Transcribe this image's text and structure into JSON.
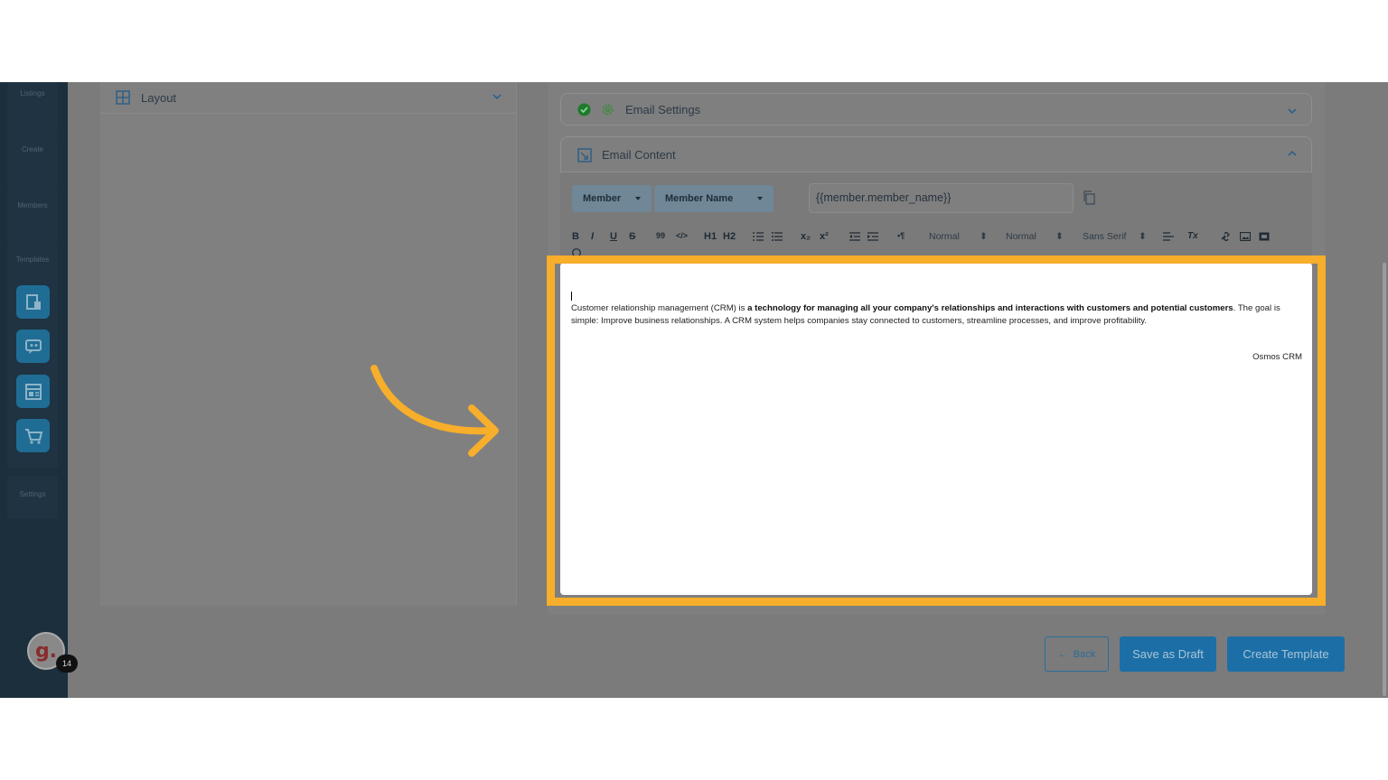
{
  "sidebar": {
    "labels": [
      "Listings",
      "Create",
      "Members",
      "Templates",
      "Settings"
    ],
    "template_buttons": [
      "document-icon",
      "chat-icon",
      "layout-icon",
      "cart-icon"
    ],
    "avatar_letter": "g.",
    "badge_count": "14"
  },
  "left_panel": {
    "title": "Layout"
  },
  "email_settings": {
    "title": "Email Settings"
  },
  "email_content": {
    "title": "Email Content",
    "selector_member": "Member",
    "selector_field": "Member Name",
    "variable_value": "{{member.member_name}}",
    "toolbar": {
      "bold": "B",
      "italic": "I",
      "underline": "U",
      "strike": "S",
      "quote": "99",
      "code": "</>",
      "h1": "H1",
      "h2": "H2",
      "sub": "x₂",
      "sup": "x²",
      "direction": "•¶",
      "size1": "Normal",
      "size2": "Normal",
      "font": "Sans Serif",
      "clear": "Tx"
    }
  },
  "editor": {
    "text_before": "Customer relationship management (CRM) is ",
    "text_bold": "a technology for managing all your company's relationships and interactions with customers and potential customers",
    "text_after": ". The goal is simple: Improve business relationships. A CRM system helps companies stay connected to customers, streamline processes, and improve profitability.",
    "signature": "Osmos CRM"
  },
  "actions": {
    "back": "Back",
    "save_draft": "Save as Draft",
    "create": "Create Template"
  },
  "colors": {
    "highlight": "#f7ae2b",
    "brand": "#1c6fa6",
    "sidebar": "#1c2f3d"
  }
}
